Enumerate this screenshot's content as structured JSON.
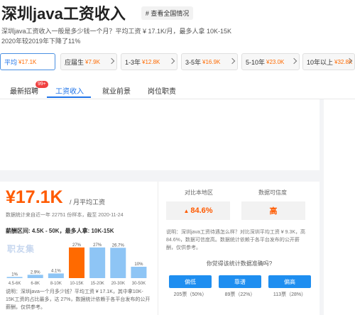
{
  "header": {
    "title": "深圳java工资收入",
    "badge": "# 查看全国情况"
  },
  "summary": {
    "line1": "深圳java工资收入一般是多少钱一个月？平均工资 ¥ 17.1K/月，最多人拿 10K-15K",
    "line2": "2020年较2019年下降了11%"
  },
  "filters": [
    {
      "label": "平均",
      "value": "¥17.1K"
    },
    {
      "label": "应届生",
      "value": "¥7.9K"
    },
    {
      "label": "1-3年",
      "value": "¥12.8K"
    },
    {
      "label": "3-5年",
      "value": "¥16.9K"
    },
    {
      "label": "5-10年",
      "value": "¥23.0K"
    },
    {
      "label": "10年以上",
      "value": "¥32.8K"
    }
  ],
  "tabs": [
    {
      "label": "最新招聘",
      "badge": "99+"
    },
    {
      "label": "工资收入"
    },
    {
      "label": "就业前景"
    },
    {
      "label": "岗位职责"
    }
  ],
  "salary": {
    "value": "¥17.1K",
    "unit": "/ 月平均工资",
    "sample": "数据统计来自近一年 22751 份样本，截至 2020-11-24",
    "range": "薪酬区间: 4.5K - 50K，最多人拿: 10K-15K",
    "watermark": "职友集",
    "note": "说明：深圳java一个月多少钱？平均工资 ¥ 17.1K，其中拿10K-15K工资的占比最多，达 27%，数据统计依赖于各平台发布的公开薪酬，仅供参考。"
  },
  "chart_data": {
    "type": "bar",
    "categories": [
      "4.5-6K",
      "6-8K",
      "8-10K",
      "10-15K",
      "15-20K",
      "20-30K",
      "30-50K"
    ],
    "values": [
      1,
      2.9,
      4.1,
      27,
      27,
      26.7,
      10
    ],
    "labels": [
      "1%",
      "2.9%",
      "4.1%",
      "27%",
      "27%",
      "26.7%",
      "10%"
    ],
    "highlight_index": 3,
    "ylim": [
      0,
      30
    ],
    "colors": {
      "bar": "#8ec5f5",
      "highlight": "#ff6a00"
    }
  },
  "compare": {
    "region_label": "对比本地区",
    "region_value": "84.6%",
    "credibility_label": "数据可信度",
    "credibility_value": "高",
    "explain": "说明：深圳java工资待遇怎么样？对比深圳平均工资 ¥ 9.3K，高 84.6%，数据可信度高。数据统计依赖于各平台发布的公开薪酬，仅供参考。",
    "question": "你觉得该统计数据准确吗?"
  },
  "votes": [
    {
      "label": "偏低",
      "count": "205票（50%）"
    },
    {
      "label": "靠谱",
      "count": "89票（22%）"
    },
    {
      "label": "偏高",
      "count": "113票（28%）"
    }
  ],
  "colors": {
    "accent": "#1e73e8",
    "salary": "#ff5a00",
    "button": "#1e8ef0"
  }
}
